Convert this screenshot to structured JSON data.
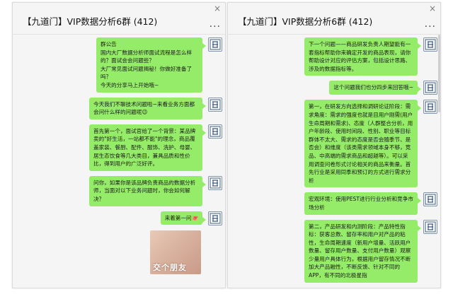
{
  "left": {
    "title": "【九道门】VIP数据分析6群 (412)",
    "close": "×",
    "more": "...",
    "messages": [
      {
        "type": "text",
        "text": "群公告\n国内大厂数据分析师面试流程是怎么样的？面试会会问题些？\n大厂常见面试问题揭秘！你做好准备了吗？\n今天的分享马上开始哦~"
      },
      {
        "type": "text",
        "text": "今天我们不聊技术问题啦~来看业务方面都会问什么样的问题呢😉"
      },
      {
        "type": "text",
        "text": "首先第一个，面试官给了一个背景：某品牌卖的\"好生活，一站都不能\"的理念，商品覆盖家装、餐厨、配件、服饰、洗护、母婴、居生态饮食等几大类目，兼具品质和性价比，得到用户的广泛好评。"
      },
      {
        "type": "text",
        "text": "问你，如果你是该品牌负责商品的数据分析师，当面对以下业务问题时，你会如何解决？"
      },
      {
        "type": "text",
        "text": "来着第一问🐙"
      },
      {
        "type": "image",
        "caption": "交个朋友"
      }
    ]
  },
  "right": {
    "title": "【九道门】VIP数据分析6群 (412)",
    "close": "×",
    "more": "...",
    "messages": [
      {
        "type": "text",
        "text": "下一个问题——商品研发负责人期望能有一套指标帮助你来确定开发的商品表现，请你帮助设计对应的评估方案，包括设计思路、涉及的数据指标等。"
      },
      {
        "type": "text",
        "text": "这个问题我们也分四步来回答哦~"
      },
      {
        "type": "text",
        "text": "第一，在研发方向选择和调研论证阶段：需求角度：需求的强度也就是目用户刚需(用户生命周期和需求)、态度（人群整合分析，用户年龄段、使用时间段、性别、职业等目标群体不太大、需求的态度是否会随季节、是否会）和维度（该类需求领域本身不够，竞品、中高端的需求商品和超越等）。可以采用调查问卷形式讨论相关的商品来衡量。首先行业是采用同季和预订的方式进行需求分析"
      },
      {
        "type": "text",
        "text": "宏观环境：使用PEST进行行业分析和竞争市场分析"
      },
      {
        "type": "text",
        "text": "第二，产品研发和内测阶段：产品特性指标：获客总数、留存率和用户对产品的粘性，生命周期速度（新用户增量、活跃用户数量、留存用户数量、支付用户数量）观察少量用户具体行为，根据用户留存情况不断加大产品融性，不断反馈、针对不同的APP，有不同的北极星指"
      }
    ]
  },
  "colors": {
    "bubble": "#95ec69",
    "window_bg": "#f5f5f5",
    "avatar_border": "#7f93ad"
  },
  "icons": {
    "avatar": "jiudaomen-logo-avatar"
  }
}
